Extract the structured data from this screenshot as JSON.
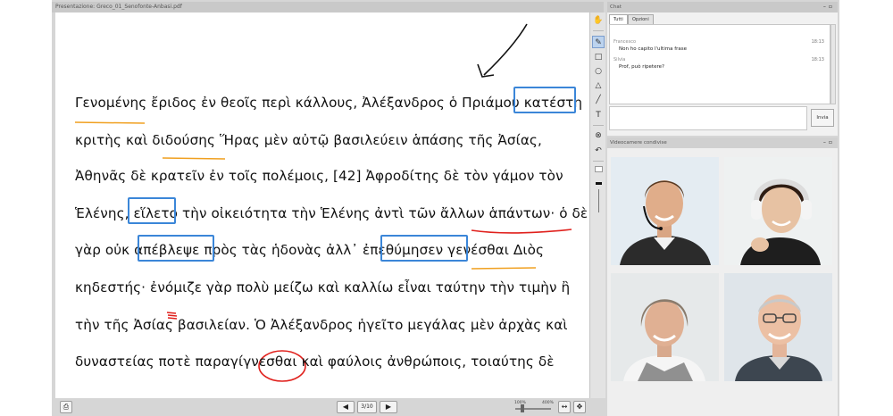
{
  "presentation": {
    "title": "Presentazione: Greco_01_Senofonte-Anbasi.pdf",
    "lines": [
      "Γενομένης ἔριδος ἐν θεοῖς περὶ κάλλους, Ἀλέξανδρος ὁ Πριάμου κατέστη",
      "κριτὴς καὶ διδούσης Ἥρας μὲν αὐτῷ βασιλεύειν ἁπάσης τῆς Ἀσίας,",
      "Ἀθηνᾶς δὲ κρατεῖν ἐν τοῖς πολέμοις, [42] Ἀφροδίτης δὲ τὸν γάμον τὸν",
      "Ἑλένης, εἵλετο τὴν οἰκειότητα τὴν Ἑλένης ἀντὶ τῶν ἄλλων ἁπάντων· ὁ δὲ",
      "γὰρ οὐκ ἀπέβλεψε πρὸς τὰς ἡδονὰς ἀλλ᾽ ἐπεθύμησεν γενέσθαι Διὸς",
      "κηδεστής· ἐνόμιζε γὰρ πολὺ μείζω καὶ καλλίω εἶναι ταύτην  τὴν τιμὴν ἢ",
      "τὴν τῆς Ἀσίας βασιλείαν. Ὁ Ἀλέξανδρος ἡγεῖτο μεγάλας μὲν ἀρχὰς καὶ",
      "δυναστείας ποτὲ παραγίγνεσθαι καὶ φαύλοις ἀνθρώποις, τοιαύτης δὲ"
    ],
    "page_indicator": "3/10",
    "zoom_min": "100%",
    "zoom_max": "400%"
  },
  "toolbar_icons": [
    "hand-icon",
    "pencil-icon",
    "rectangle-icon",
    "circle-icon",
    "triangle-icon",
    "line-icon",
    "text-icon",
    "clear-icon",
    "undo-icon",
    "color-swatch-icon",
    "stroke-width-icon",
    "thickness-slider-icon"
  ],
  "chat": {
    "title": "Chat",
    "tabs": [
      "Tutti",
      "Opzioni"
    ],
    "messages": [
      {
        "name": "Francesco",
        "time": "18:13",
        "text": "Non ho capito l'ultima frase"
      },
      {
        "name": "Silvia",
        "time": "18:13",
        "text": "Prof, può ripetere?"
      }
    ],
    "send_label": "Invia"
  },
  "cameras": {
    "title": "Videocamere condivise",
    "feeds": [
      "young-man-headset",
      "young-woman-headphones",
      "middle-aged-woman",
      "older-man-glasses"
    ]
  },
  "colors": {
    "highlight_box": "#3b86d8",
    "underline_orange": "#f0a020",
    "underline_red": "#e0201c",
    "panel_bg": "#d6d6d6"
  }
}
